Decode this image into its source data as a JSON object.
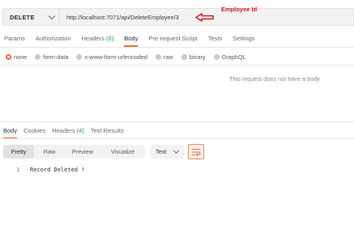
{
  "request": {
    "method": "DELETE",
    "url": "http://localhost:7071/api/DeleteEmployee/3"
  },
  "annotation": {
    "label": "Employee Id",
    "color": "#e0161c"
  },
  "request_tabs": [
    {
      "label": "Params",
      "count": ""
    },
    {
      "label": "Authorization",
      "count": ""
    },
    {
      "label": "Headers",
      "count": "(6)"
    },
    {
      "label": "Body",
      "count": "",
      "active": true
    },
    {
      "label": "Pre-request Script",
      "count": ""
    },
    {
      "label": "Tests",
      "count": ""
    },
    {
      "label": "Settings",
      "count": ""
    }
  ],
  "body_types": [
    {
      "label": "none",
      "selected": true
    },
    {
      "label": "form-data"
    },
    {
      "label": "x-www-form-urlencoded"
    },
    {
      "label": "raw"
    },
    {
      "label": "binary"
    },
    {
      "label": "GraphQL"
    }
  ],
  "no_body_message": "This request does not have a body",
  "response_tabs": [
    {
      "label": "Body",
      "count": "",
      "active": true
    },
    {
      "label": "Cookies",
      "count": ""
    },
    {
      "label": "Headers",
      "count": "(4)"
    },
    {
      "label": "Test Results",
      "count": ""
    }
  ],
  "view_modes": [
    "Pretty",
    "Raw",
    "Preview",
    "Visualize"
  ],
  "format": "Text",
  "response_lines": [
    {
      "num": "1",
      "text": "Record Deleted !"
    }
  ],
  "colors": {
    "accent": "#f26b3a",
    "count_green": "#1a9a4a"
  }
}
